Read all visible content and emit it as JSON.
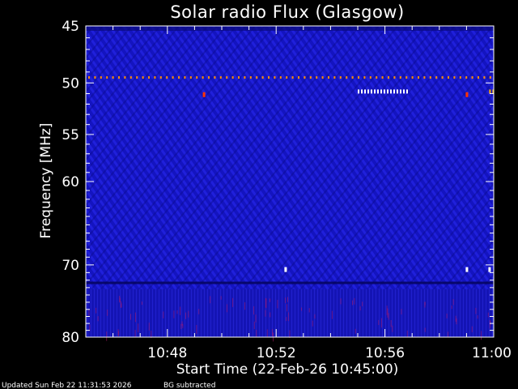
{
  "chart_data": {
    "type": "heatmap",
    "title": "Solar radio Flux (Glasgow)",
    "xlabel": "Start Time (22-Feb-26 10:45:00)",
    "ylabel": "Frequency [MHz]",
    "x_ticks": [
      "10:48",
      "10:52",
      "10:56",
      "11:00"
    ],
    "x_tick_minutes": [
      48,
      52,
      56,
      60
    ],
    "x_range_minutes": [
      45,
      60
    ],
    "y_ticks": [
      "45",
      "50",
      "55",
      "60",
      "70",
      "80"
    ],
    "y_tick_values": [
      45,
      50,
      55,
      60,
      70,
      80
    ],
    "y_range": [
      45,
      80
    ],
    "y_scale": "log",
    "colormap": [
      "#000080",
      "#1a1ad6",
      "#ff0000",
      "#ffa500",
      "#ffffff"
    ],
    "background_level": "low (blue)",
    "features": [
      {
        "description": "narrowband interference line",
        "frequency_mhz": 49.5,
        "time_range": [
          "10:45",
          "11:00"
        ],
        "color": "#ff8c00"
      },
      {
        "description": "bright burst",
        "frequency_mhz": 50.8,
        "time_range": [
          "10:55:00",
          "10:56:50"
        ],
        "color": "#ffffff"
      },
      {
        "description": "bright burst",
        "frequency_mhz": 50.8,
        "time_range": [
          "10:59:50",
          "11:00"
        ],
        "color": "#ffb000"
      },
      {
        "description": "spike",
        "frequency_mhz": 51.1,
        "time": "10:49:20",
        "color": "#ff3300"
      },
      {
        "description": "spike",
        "frequency_mhz": 51.1,
        "time": "10:59:00",
        "color": "#ff3300"
      },
      {
        "description": "spike",
        "frequency_mhz": 70.6,
        "time": "10:52:20",
        "color": "#ffffff"
      },
      {
        "description": "spike",
        "frequency_mhz": 70.6,
        "time": "10:59:00",
        "color": "#ffffff"
      },
      {
        "description": "spike",
        "frequency_mhz": 70.6,
        "time": "10:59:50",
        "color": "#ffffff"
      }
    ]
  },
  "footer": {
    "updated": "Updated Sun Feb 22 11:31:53 2026",
    "note": "BG subtracted"
  }
}
